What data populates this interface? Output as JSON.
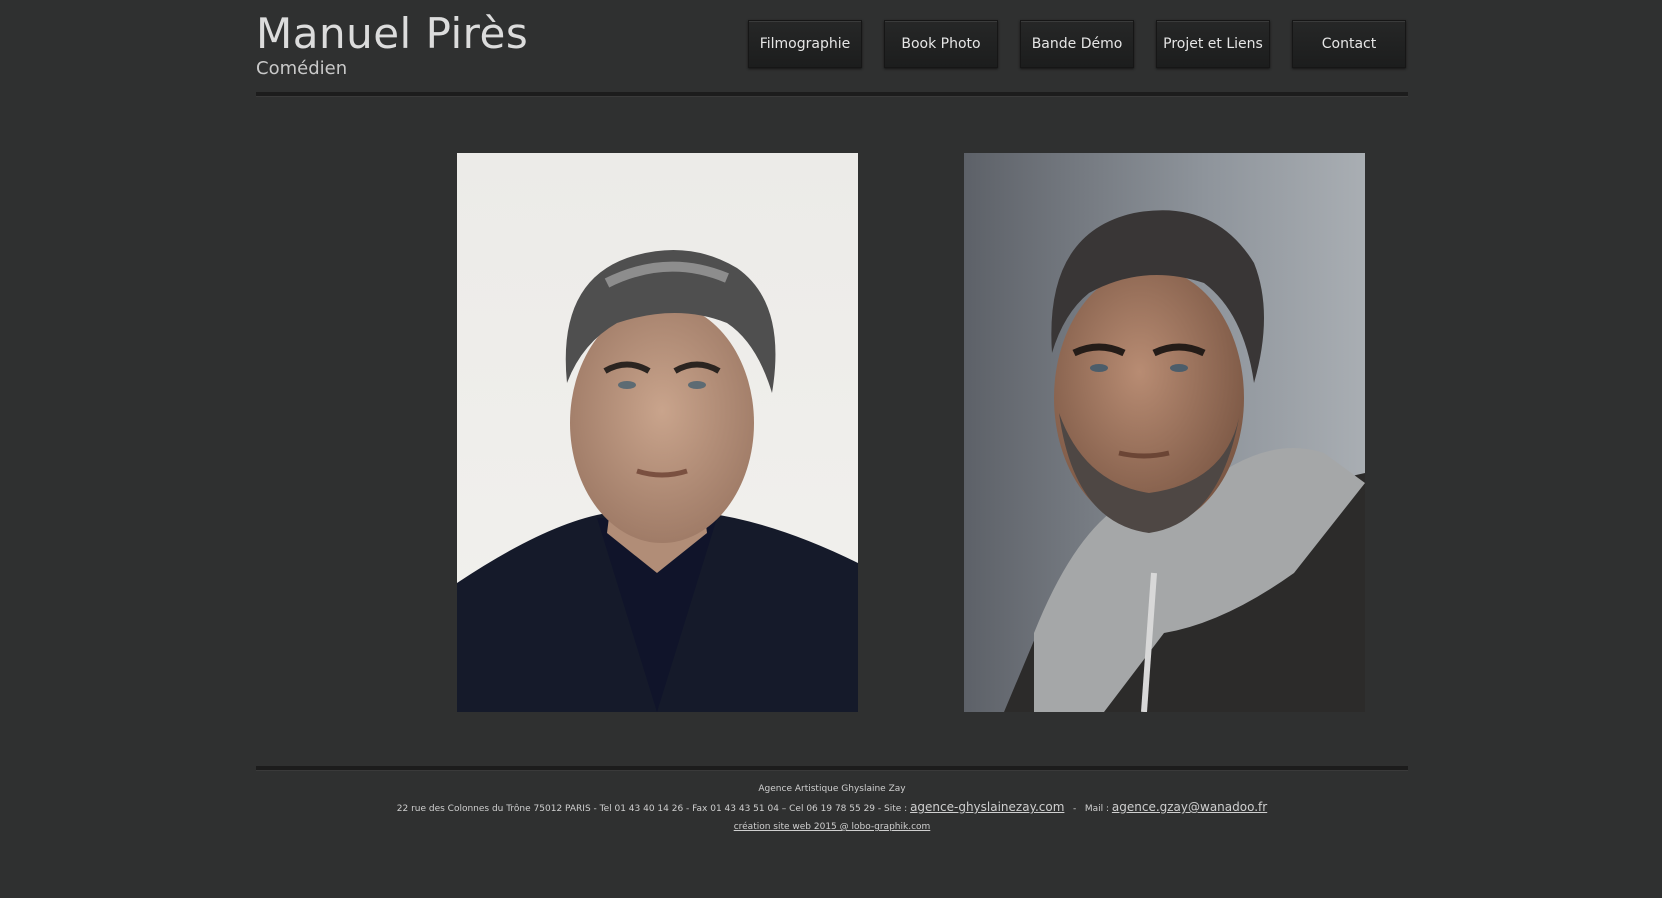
{
  "header": {
    "title": "Manuel Pirès",
    "subtitle": "Comédien"
  },
  "nav": {
    "items": [
      {
        "label": "Filmographie"
      },
      {
        "label": "Book Photo"
      },
      {
        "label": "Bande Démo"
      },
      {
        "label": "Projet et Liens"
      },
      {
        "label": "Contact"
      }
    ]
  },
  "gallery": {
    "photos": [
      {
        "alt": "portrait-suit"
      },
      {
        "alt": "portrait-hoodie"
      }
    ]
  },
  "footer": {
    "agency": "Agence Artistique Ghyslaine Zay",
    "address": "22 rue des Colonnes du Trône 75012 PARIS  - Tel 01 43 40 14 26   -  Fax 01 43 43 51 04 – Cel 06 19 78 55 29 - Site :",
    "site_link": "agence-ghyslainezay.com",
    "mail_label": "  -   Mail :",
    "mail_link": "agence.gzay@wanadoo.fr",
    "credit": "création site web 2015 @ lobo-graphik.com"
  },
  "colors": {
    "background": "#2f3030",
    "button": "#222323",
    "text": "#d8d8d8"
  }
}
